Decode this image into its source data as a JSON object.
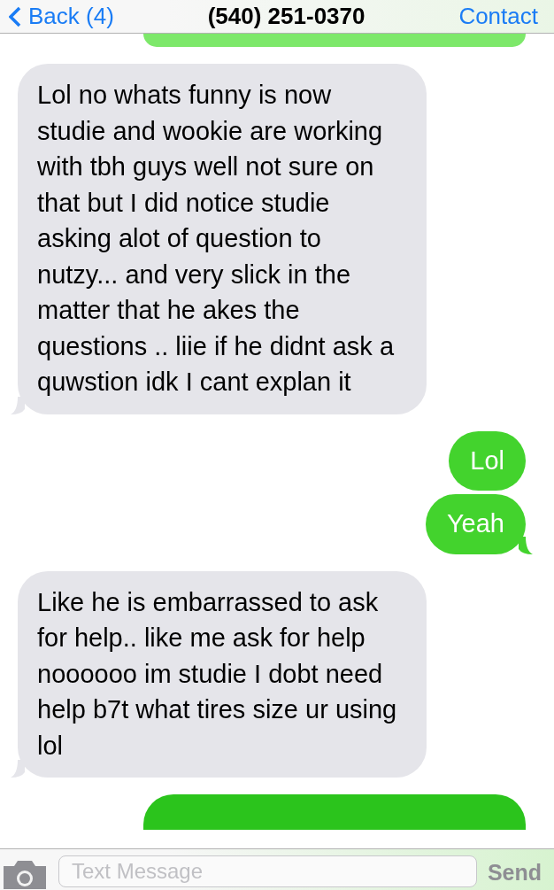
{
  "nav_bar": {
    "back": "Back (4)",
    "title": "(540) 251-0370",
    "action": "Contact"
  },
  "messages": [
    {
      "kind": "partial-outgoing"
    },
    {
      "kind": "incoming",
      "text": "Lol no whats funny is now studie and wookie are working with tbh guys well not sure on that but I did notice studie asking alot of question to nutzy... and very slick in the matter that he akes the questions .. liie if he didnt ask a quwstion idk I cant explan it"
    },
    {
      "kind": "outgoing",
      "text": "Lol"
    },
    {
      "kind": "outgoing",
      "text": "Yeah"
    },
    {
      "kind": "incoming",
      "text": "Like he is embarrassed to ask for help.. like me ask for help noooooo im studie I dobt need help b7t what tires size ur using lol"
    },
    {
      "kind": "partial-outgoing"
    }
  ],
  "compose_bar": {
    "placeholder": "Text Message",
    "send": "Send"
  }
}
